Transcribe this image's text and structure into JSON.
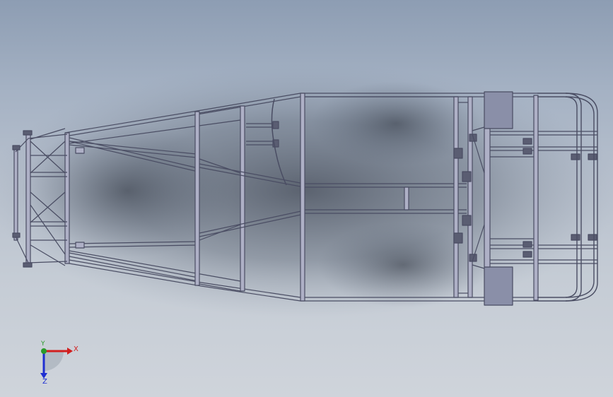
{
  "viewport": {
    "background_top": "#8d9db3",
    "background_bottom": "#cfd4db",
    "frame_color": "#4a4d63",
    "tube_fill": "#aeb0c6",
    "panel_fill": "#8a8fa8"
  },
  "triad": {
    "x_label": "X",
    "y_label": "Y",
    "z_label": "Z",
    "x_color": "#d11f1f",
    "y_color": "#2a9a2a",
    "z_color": "#1f2fd1"
  }
}
